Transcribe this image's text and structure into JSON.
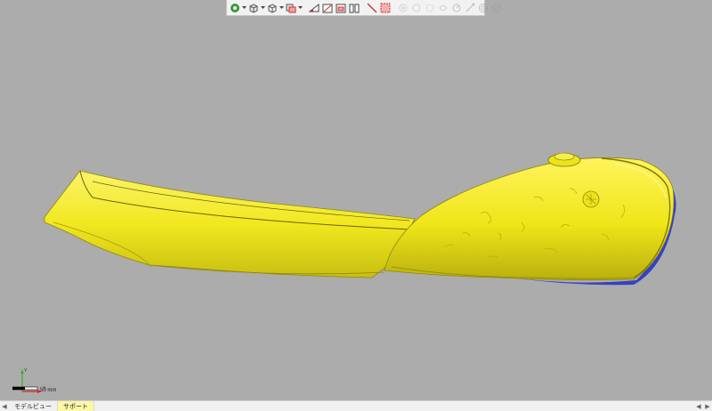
{
  "toolbar": {
    "buttons": [
      {
        "icon": "view-mode-icon",
        "enabled": true,
        "caret": true
      },
      {
        "icon": "cube-view-icon",
        "enabled": true,
        "caret": true
      },
      {
        "icon": "cube-wire-icon",
        "enabled": true,
        "caret": true
      },
      {
        "icon": "object-display-icon",
        "enabled": true,
        "caret": true
      },
      {
        "icon": "section-plane-icon",
        "enabled": true,
        "caret": false
      },
      {
        "icon": "section-view-icon",
        "enabled": true,
        "caret": false
      },
      {
        "icon": "clip-view-icon",
        "enabled": true,
        "caret": false
      },
      {
        "icon": "split-view-icon",
        "enabled": true,
        "caret": false
      },
      {
        "icon": "select-line-icon",
        "enabled": true,
        "caret": false
      },
      {
        "icon": "rectangle-select-icon",
        "enabled": true,
        "caret": false
      },
      {
        "icon": "lasso-select-icon",
        "enabled": false,
        "caret": false
      },
      {
        "icon": "brush-select-icon",
        "enabled": false,
        "caret": false
      },
      {
        "icon": "surface-select-icon",
        "enabled": false,
        "caret": false
      },
      {
        "icon": "invert-select-icon",
        "enabled": false,
        "caret": false
      },
      {
        "icon": "visible-select-icon",
        "enabled": false,
        "caret": false
      },
      {
        "icon": "grow-select-icon",
        "enabled": false,
        "caret": false
      },
      {
        "icon": "shrink-select-icon",
        "enabled": false,
        "caret": false
      },
      {
        "icon": "deselect-icon",
        "enabled": false,
        "caret": false
      }
    ]
  },
  "scale_bar": {
    "label": "50 mm"
  },
  "axis": {
    "x_label": "X",
    "y_label": "Y"
  },
  "statusbar": {
    "tabs": [
      {
        "label": "モデルビュー",
        "active": false
      },
      {
        "label": "サポート",
        "active": true
      }
    ]
  },
  "colors": {
    "viewport": "#acacac",
    "model_fill": "#f2ea1a",
    "model_shadow": "#c9c014",
    "model_underside": "#3440c8",
    "active_tab": "#fff6a8"
  }
}
